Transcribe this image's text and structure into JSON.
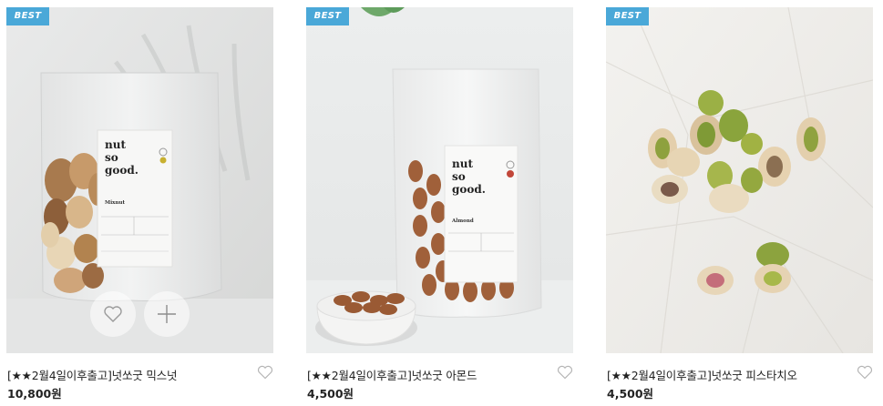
{
  "products": [
    {
      "badge": "BEST",
      "name": "[★★2월4일이후출고]넛쏘굿 믹스넛",
      "price": "10,800원",
      "bag_brand": [
        "nut",
        "so",
        "good."
      ],
      "bag_variant": "Mixnut"
    },
    {
      "badge": "BEST",
      "name": "[★★2월4일이후출고]넛쏘굿 아몬드",
      "price": "4,500원",
      "bag_brand": [
        "nut",
        "so",
        "good."
      ],
      "bag_variant": "Almond"
    },
    {
      "badge": "BEST",
      "name": "[★★2월4일이후출고]넛쏘굿 피스타치오",
      "price": "4,500원"
    }
  ],
  "colors": {
    "badge_bg": "#4aa8d8",
    "text": "#222222",
    "heart_stroke": "#b5b5b5"
  },
  "icons": {
    "wishlist": "heart-outline-icon",
    "hover_wishlist": "heart-icon",
    "hover_add": "plus-icon"
  }
}
